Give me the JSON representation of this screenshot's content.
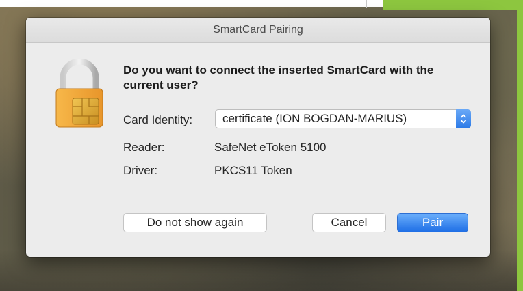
{
  "dialog": {
    "title": "SmartCard Pairing",
    "question": "Do you want to connect the inserted SmartCard with the current user?",
    "fields": {
      "card_identity_label": "Card Identity:",
      "card_identity_value": "certificate (ION BOGDAN-MARIUS)",
      "reader_label": "Reader:",
      "reader_value": "SafeNet eToken 5100",
      "driver_label": "Driver:",
      "driver_value": "PKCS11 Token"
    },
    "buttons": {
      "dont_show": "Do not show again",
      "cancel": "Cancel",
      "pair": "Pair"
    }
  },
  "icons": {
    "lock": "smartcard-lock-icon",
    "stepper": "up-down-chevron-icon"
  },
  "colors": {
    "accent": "#2b7ae7",
    "lock_body": "#f2a93b",
    "chip": "#e2b13c",
    "frame_green": "#8dc63f"
  }
}
